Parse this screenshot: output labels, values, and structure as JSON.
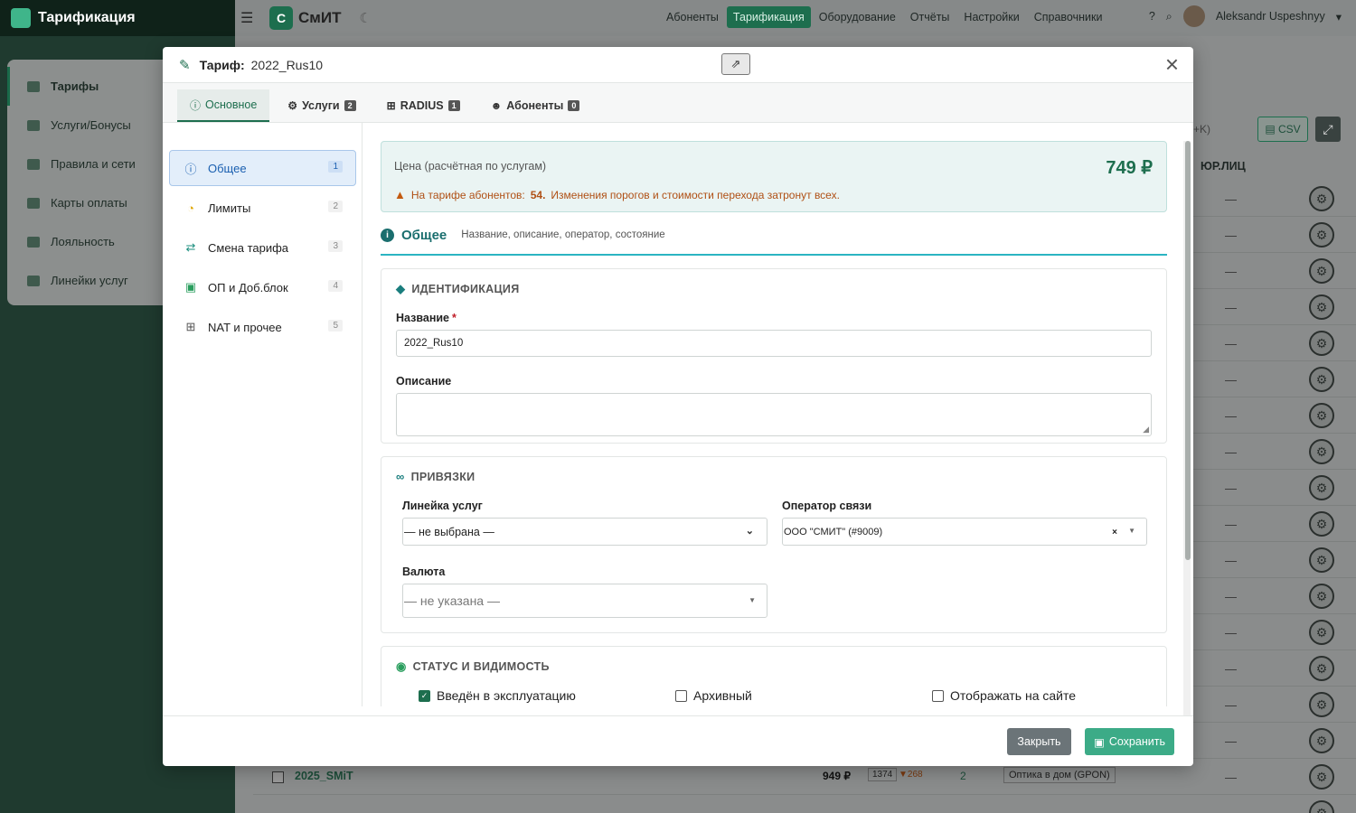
{
  "app": {
    "brand": "Тарификация",
    "logo_letter": "С",
    "logo_text": "СмИТ",
    "sidebar": [
      {
        "label": "Тарифы",
        "active": true
      },
      {
        "label": "Услуги/Бонусы"
      },
      {
        "label": "Правила и сети"
      },
      {
        "label": "Карты оплаты"
      },
      {
        "label": "Лояльность"
      },
      {
        "label": "Линейки услуг"
      }
    ],
    "nav": [
      {
        "label": "Абоненты"
      },
      {
        "label": "Тарификация",
        "active": true
      },
      {
        "label": "Оборудование"
      },
      {
        "label": "Отчёты"
      },
      {
        "label": "Настройки"
      },
      {
        "label": "Справочники"
      }
    ],
    "user": "Aleksandr Uspeshnyy",
    "csv_label": "CSV",
    "shortcut_hint": "+K)",
    "column_header": "ЮР.ЛИЦ",
    "dash": "—",
    "rows": [
      {
        "name": "2025_SMiT",
        "price": "949 ₽",
        "count": "1374",
        "delta": "▼268",
        "num": "2",
        "tag": "Оптика в дом (GPON)"
      }
    ]
  },
  "modal": {
    "title_label": "Тариф:",
    "title_value": "2022_Rus10",
    "tabs": [
      {
        "label": "Основное",
        "active": true
      },
      {
        "label": "Услуги",
        "badge": "2"
      },
      {
        "label": "RADIUS",
        "badge": "1"
      },
      {
        "label": "Абоненты",
        "badge": "0"
      }
    ],
    "sections": [
      {
        "label": "Общее",
        "num": "1",
        "active": true
      },
      {
        "label": "Лимиты",
        "num": "2"
      },
      {
        "label": "Смена тарифа",
        "num": "3"
      },
      {
        "label": "ОП и Доб.блок",
        "num": "4"
      },
      {
        "label": "NAT и прочее",
        "num": "5"
      }
    ],
    "price": {
      "label": "Цена (расчётная по услугам)",
      "value": "749 ₽",
      "warning_prefix": "На тарифе абонентов:",
      "warning_count": "54.",
      "warning_suffix": "Изменения порогов и стоимости перехода затронут всех."
    },
    "section_head": {
      "title": "Общее",
      "subtitle": "Название, описание, оператор, состояние"
    },
    "identification": {
      "title": "ИДЕНТИФИКАЦИЯ",
      "name_label": "Название",
      "required_mark": "*",
      "name_value": "2022_Rus10",
      "desc_label": "Описание",
      "desc_value": ""
    },
    "bindings": {
      "title": "ПРИВЯЗКИ",
      "line_label": "Линейка услуг",
      "line_value": "— не выбрана —",
      "operator_label": "Оператор связи",
      "operator_value": "ООО \"СМИТ\" (#9009)",
      "currency_label": "Валюта",
      "currency_value": "— не указана —"
    },
    "status": {
      "title": "СТАТУС И ВИДИМОСТЬ",
      "checks": [
        {
          "label": "Введён в эксплуатацию",
          "checked": true
        },
        {
          "label": "Архивный",
          "checked": false
        },
        {
          "label": "Отображать на сайте",
          "checked": false
        }
      ]
    },
    "footer": {
      "close_label": "Закрыть",
      "save_label": "Сохранить"
    }
  },
  "colors": {
    "accent": "#1d6e4e",
    "save": "#3cab87",
    "warning": "#b05015",
    "info_line": "#2bb4c2"
  }
}
